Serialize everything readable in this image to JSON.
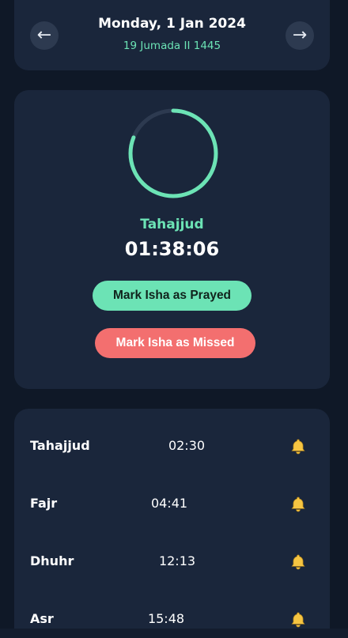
{
  "header": {
    "prev_icon": "left-arrow-icon",
    "prev_glyph": "←",
    "next_icon": "right-arrow-icon",
    "next_glyph": "→",
    "date": "Monday, 1 Jan 2024",
    "hijri_date": "19 Jumada II 1445"
  },
  "timer": {
    "progress": 0.81,
    "track_color": "#2d3a50",
    "progress_color": "#6ce3b5",
    "prayer": "Tahajjud",
    "countdown": "01:38:06",
    "mark_prayed_label": "Mark Isha as Prayed",
    "mark_missed_label": "Mark Isha as Missed"
  },
  "prayers": [
    {
      "name": "Tahajjud",
      "time": "02:30",
      "icon": "bell-icon"
    },
    {
      "name": "Fajr",
      "time": "04:41",
      "icon": "bell-icon"
    },
    {
      "name": "Dhuhr",
      "time": "12:13",
      "icon": "bell-icon"
    },
    {
      "name": "Asr",
      "time": "15:48",
      "icon": "bell-icon"
    }
  ],
  "colors": {
    "background": "#0f1827",
    "card": "#1a263b",
    "accent": "#6ce3b5",
    "danger": "#f36f6f",
    "bell": "#f6c542"
  }
}
